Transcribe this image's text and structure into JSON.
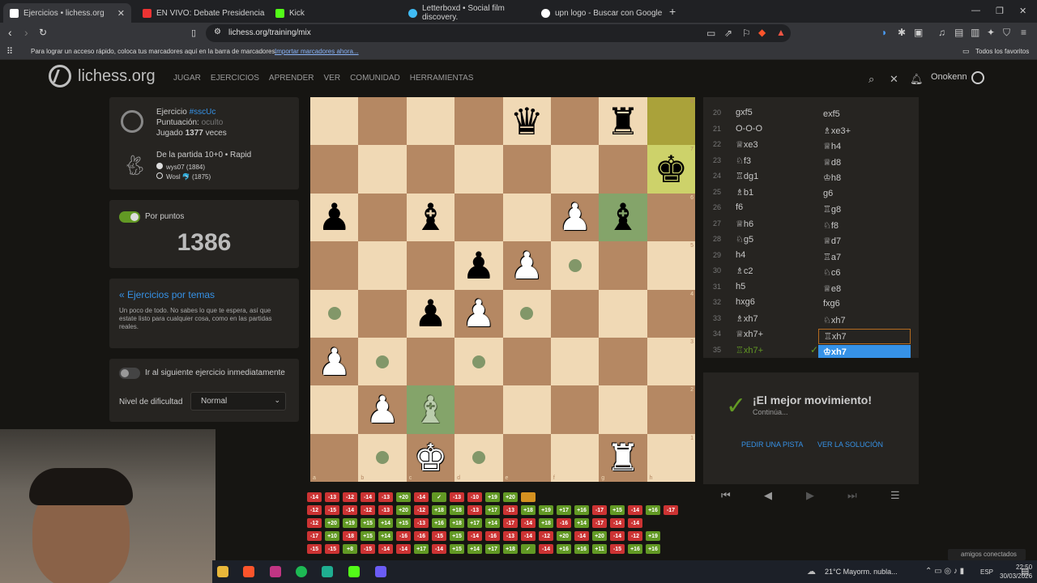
{
  "browser": {
    "tabs": [
      {
        "title": "Ejercicios • lichess.org",
        "active": true
      },
      {
        "title": "EN VIVO: Debate Presidencia"
      },
      {
        "title": "Kick"
      },
      {
        "title": "Letterboxd • Social film discovery."
      },
      {
        "title": "upn logo - Buscar con Google"
      }
    ],
    "url": "lichess.org/training/mix",
    "bookmarks_text": "Para lograr un acceso rápido, coloca tus marcadores aquí en la barra de marcadores.",
    "bookmarks_link": "Importar marcadores ahora...",
    "bookmarks_all": "Todos los favoritos"
  },
  "site": {
    "logo": "lichess.org",
    "nav": [
      "JUGAR",
      "EJERCICIOS",
      "APRENDER",
      "VER",
      "COMUNIDAD",
      "HERRAMIENTAS"
    ],
    "username": "Onokenn"
  },
  "puzzle": {
    "label": "Ejercicio",
    "id": "#sscUc",
    "rating_label": "Puntuación:",
    "rating_value": "oculto",
    "played_pre": "Jugado",
    "played_count": "1377",
    "played_post": "veces",
    "game": "De la partida 10+0 • Rapid",
    "white_player": "wys07 (1884)",
    "black_player": "Wosl 🐬 (1875)"
  },
  "score": {
    "toggle_label": "Por puntos",
    "value": "1386"
  },
  "themes": {
    "link": "« Ejercicios por temas",
    "desc": "Un poco de todo. No sabes lo que te espera, así que estate listo para cualquier cosa, como en las partidas reales."
  },
  "settings": {
    "auto_next": "Ir al siguiente ejercicio inmediatamente",
    "difficulty_label": "Nivel de dificultad",
    "difficulty_value": "Normal"
  },
  "board": {
    "rows": [
      [
        "",
        "",
        "",
        "",
        "bq",
        "",
        "br",
        ""
      ],
      [
        "",
        "",
        "",
        "",
        "",
        "",
        "",
        "bk"
      ],
      [
        "bp",
        "",
        "bb",
        "",
        "",
        "wp",
        "bb",
        ""
      ],
      [
        "",
        "",
        "",
        "bp",
        "wp",
        "",
        "",
        ""
      ],
      [
        "",
        "",
        "bp",
        "wp",
        "",
        "",
        "",
        ""
      ],
      [
        "wp",
        "",
        "",
        "",
        "",
        "",
        "",
        ""
      ],
      [
        "",
        "wp",
        "wb",
        "",
        "",
        "",
        "",
        ""
      ],
      [
        "",
        "",
        "wk",
        "",
        "",
        "",
        "wr",
        ""
      ]
    ],
    "files": [
      "a",
      "b",
      "c",
      "d",
      "e",
      "f",
      "g",
      "h"
    ],
    "ranks": [
      "8",
      "7",
      "6",
      "5",
      "4",
      "3",
      "2",
      "1"
    ]
  },
  "moves": [
    {
      "n": "20",
      "w": "gxf5",
      "b": "exf5"
    },
    {
      "n": "21",
      "w": "O-O-O",
      "b": "♗xe3+"
    },
    {
      "n": "22",
      "w": "♕xe3",
      "b": "♕h4"
    },
    {
      "n": "23",
      "w": "♘f3",
      "b": "♕d8"
    },
    {
      "n": "24",
      "w": "♖dg1",
      "b": "♔h8"
    },
    {
      "n": "25",
      "w": "♗b1",
      "b": "g6"
    },
    {
      "n": "26",
      "w": "f6",
      "b": "♖g8"
    },
    {
      "n": "27",
      "w": "♕h6",
      "b": "♘f8"
    },
    {
      "n": "28",
      "w": "♘g5",
      "b": "♕d7"
    },
    {
      "n": "29",
      "w": "h4",
      "b": "♖a7"
    },
    {
      "n": "30",
      "w": "♗c2",
      "b": "♘c6"
    },
    {
      "n": "31",
      "w": "h5",
      "b": "♕e8"
    },
    {
      "n": "32",
      "w": "hxg6",
      "b": "fxg6"
    },
    {
      "n": "33",
      "w": "♗xh7",
      "b": "♘xh7"
    },
    {
      "n": "34",
      "w": "♕xh7+",
      "b": "♖xh7"
    },
    {
      "n": "35",
      "w": "♖xh7+",
      "b": "♔xh7"
    }
  ],
  "feedback": {
    "title": "¡El mejor movimiento!",
    "sub": "Continúa...",
    "hint": "PEDIR UNA PISTA",
    "solution": "VER LA SOLUCIÓN"
  },
  "streak_rows": [
    [
      "-14",
      "-13",
      "-12",
      "-14",
      "-13",
      "+20",
      "-14",
      "✓",
      "-13",
      "-10",
      "+19",
      "+20",
      ""
    ],
    [
      "-12",
      "-15",
      "-14",
      "-12",
      "-13",
      "+20",
      "-12",
      "+18",
      "+18",
      "-13",
      "+17",
      "-13",
      "+18",
      "+19",
      "+17",
      "+16",
      "-17",
      "+15",
      "-14",
      "+16",
      "-17"
    ],
    [
      "-12",
      "+20",
      "+19",
      "+15",
      "+14",
      "+15",
      "-13",
      "+16",
      "+18",
      "+17",
      "+14",
      "-17",
      "-14",
      "+18",
      "-16",
      "+14",
      "-17",
      "-14",
      "-14"
    ],
    [
      "-17",
      "+10",
      "-18",
      "+15",
      "+14",
      "-16",
      "-16",
      "-15",
      "+15",
      "-14",
      "-16",
      "-13",
      "-14",
      "-12",
      "+20",
      "-14",
      "+20",
      "-14",
      "-12",
      "+19"
    ],
    [
      "-15",
      "-15",
      "+8",
      "-15",
      "-14",
      "-14",
      "+17",
      "-14",
      "+15",
      "+14",
      "+17",
      "+18",
      "✓",
      "-14",
      "+16",
      "+16",
      "+11",
      "-15",
      "+16",
      "+16"
    ]
  ],
  "system": {
    "weather": "21°C  Mayorm. nubla...",
    "lang": "ESP",
    "time": "22:50",
    "date": "30/03/2026",
    "friends": "amigos conectados"
  }
}
